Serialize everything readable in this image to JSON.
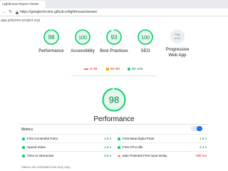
{
  "browser": {
    "tab_title": "Lighthouse Report Viewer",
    "url": "https://googlechrome.github.io/lighthouse/viewer/"
  },
  "report": {
    "page_url": "app.pollymer-project.org/"
  },
  "categories": [
    {
      "label": "Performance",
      "score": "98",
      "value": 98
    },
    {
      "label": "Accessibility",
      "score": "100",
      "value": 100
    },
    {
      "label": "Best Practices",
      "score": "93",
      "value": 93
    },
    {
      "label": "SEO",
      "score": "100",
      "value": 100
    }
  ],
  "pwa": {
    "badge": "PWA",
    "label_line1": "Progressive",
    "label_line2": "Web App"
  },
  "legend": {
    "fail": "0–49",
    "average": "50–89",
    "pass": "90–100"
  },
  "performance": {
    "score": "98",
    "value": 98,
    "title": "Performance"
  },
  "metrics": {
    "header": "Metrics",
    "items": [
      {
        "name": "First Contentful Paint",
        "value": "1.9 s",
        "status": "pass"
      },
      {
        "name": "First Meaningful Paint",
        "value": "1.9 s",
        "status": "pass"
      },
      {
        "name": "Speed Index",
        "value": "1.9 s",
        "status": "pass"
      },
      {
        "name": "First CPU Idle",
        "value": "2.4 s",
        "status": "pass"
      },
      {
        "name": "Time to Interactive",
        "value": "3.9 s",
        "status": "pass"
      },
      {
        "name": "Max Potential First Input Delay",
        "value": "290 ms",
        "status": "fail"
      }
    ],
    "footnote": "Values are estimated and may vary."
  },
  "colors": {
    "pass": "#0cce6b",
    "pass_text": "#018642",
    "average": "#ffa400",
    "fail": "#ff4e42",
    "fail_text": "#eb0f00",
    "gauge_track": "#e6f8ee",
    "accent": "#1a73e8"
  }
}
